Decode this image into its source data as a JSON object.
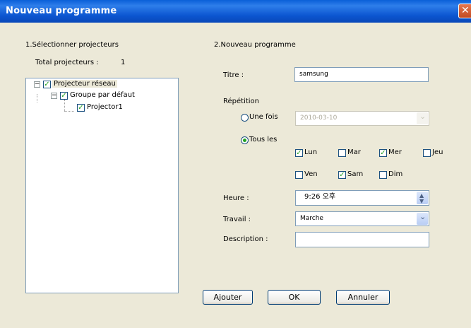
{
  "window": {
    "title": "Nouveau programme"
  },
  "left": {
    "section_title": "1.Sélectionner projecteurs",
    "total_label": "Total projecteurs :",
    "total_value": "1",
    "tree": {
      "root": "Projecteur réseau",
      "group": "Groupe par défaut",
      "leaf": "Projector1"
    }
  },
  "right": {
    "section_title": "2.Nouveau programme",
    "titre_label": "Titre :",
    "titre_value": "samsung",
    "repetition_label": "Répétition",
    "une_fois_label": "Une fois",
    "date_value": "2010-03-10",
    "tous_les_label": "Tous les",
    "days": [
      {
        "label": "Lun",
        "checked": true
      },
      {
        "label": "Mar",
        "checked": false
      },
      {
        "label": "Mer",
        "checked": true
      },
      {
        "label": "Jeu",
        "checked": false
      },
      {
        "label": "Ven",
        "checked": false
      },
      {
        "label": "Sam",
        "checked": true
      },
      {
        "label": "Dim",
        "checked": false
      }
    ],
    "heure_label": "Heure :",
    "heure_value": "9:26 오후",
    "travail_label": "Travail :",
    "travail_value": "Marche",
    "description_label": "Description :",
    "description_value": ""
  },
  "buttons": {
    "ajouter": "Ajouter",
    "ok": "OK",
    "annuler": "Annuler"
  },
  "colors": {
    "titlebar": "#0A5FD8",
    "check": "#21A121",
    "dialog_bg": "#ECE9D8"
  }
}
